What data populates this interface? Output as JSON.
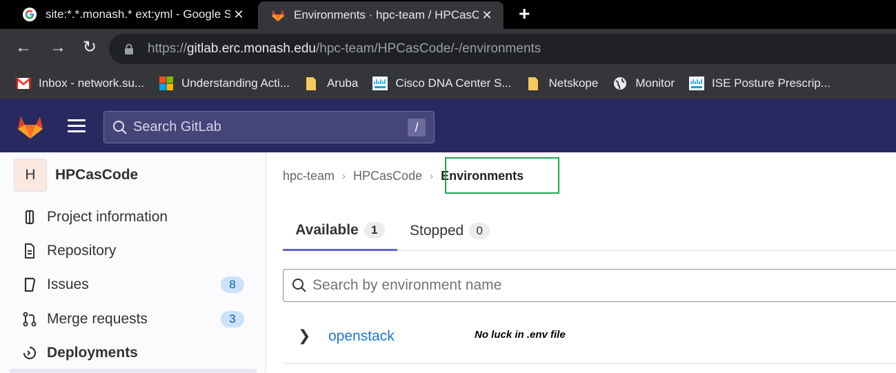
{
  "browser": {
    "tabs": [
      {
        "title": "site:*.*.monash.* ext:yml - Google Search",
        "icon": "google-icon",
        "active": false
      },
      {
        "title": "Environments · hpc-team / HPCasCode · GitLab",
        "icon": "gitlab-icon",
        "active": true
      }
    ],
    "close_glyph": "✕",
    "new_tab_glyph": "+",
    "url": {
      "scheme": "https://",
      "host": "gitlab.erc.monash.edu",
      "path": "/hpc-team/HPCasCode/-/environments"
    },
    "bookmarks": [
      {
        "label": "Inbox - network.su...",
        "icon": "gmail-icon"
      },
      {
        "label": "Understanding Acti...",
        "icon": "microsoft-icon"
      },
      {
        "label": "Aruba",
        "icon": "folder-icon"
      },
      {
        "label": "Cisco DNA Center S...",
        "icon": "cisco-icon"
      },
      {
        "label": "Netskope",
        "icon": "folder-icon"
      },
      {
        "label": "Monitor",
        "icon": "globe-icon"
      },
      {
        "label": "ISE Posture Prescrip...",
        "icon": "cisco-icon"
      }
    ]
  },
  "gitlab_header": {
    "search_placeholder": "Search GitLab",
    "search_shortcut": "/"
  },
  "sidebar": {
    "project_initial": "H",
    "project_name": "HPCasCode",
    "items": [
      {
        "label": "Project information",
        "icon": "info-icon",
        "badge": null
      },
      {
        "label": "Repository",
        "icon": "document-icon",
        "badge": null
      },
      {
        "label": "Issues",
        "icon": "issues-icon",
        "badge": "8"
      },
      {
        "label": "Merge requests",
        "icon": "merge-request-icon",
        "badge": "3"
      },
      {
        "label": "Deployments",
        "icon": "deployments-icon",
        "badge": null
      }
    ]
  },
  "breadcrumb": [
    "hpc-team",
    "HPCasCode",
    "Environments"
  ],
  "env_tabs": [
    {
      "label": "Available",
      "count": "1"
    },
    {
      "label": "Stopped",
      "count": "0"
    }
  ],
  "env_search_placeholder": "Search by environment name",
  "environments": [
    {
      "name": "openstack"
    }
  ],
  "annotation": "No luck in .env file",
  "colors": {
    "gitlab_header": "#292961",
    "highlight_box": "#1fa84f",
    "link": "#1f75cb",
    "tab_underline": "#6666c4"
  }
}
